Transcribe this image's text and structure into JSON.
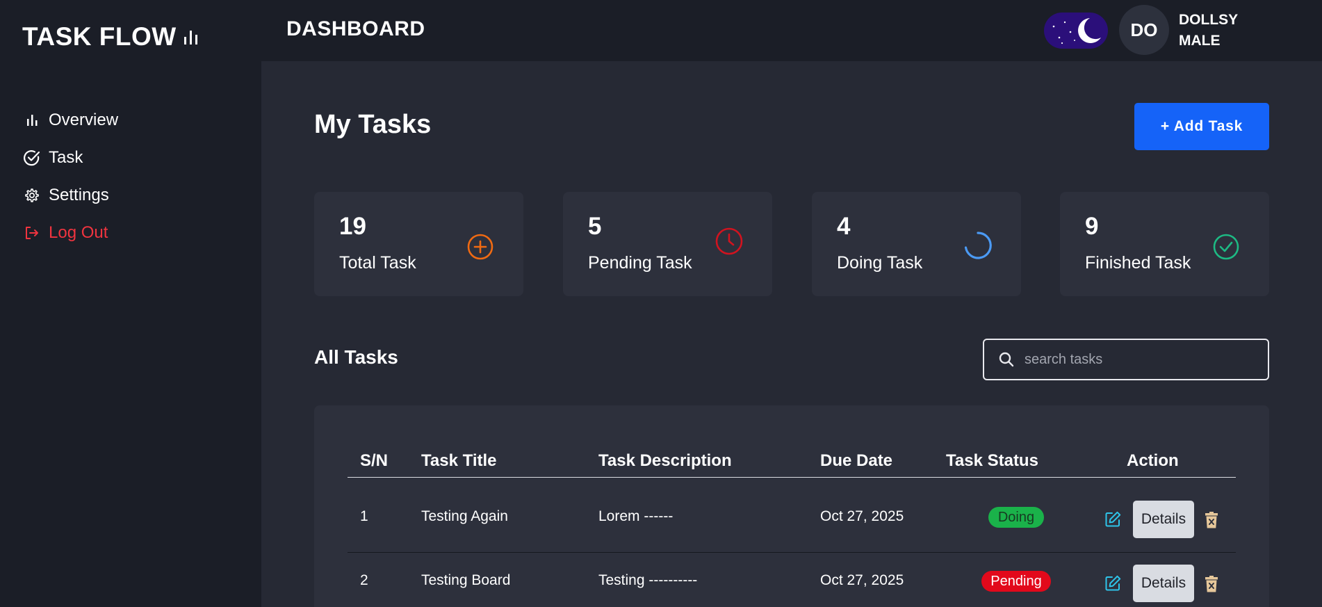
{
  "brand": {
    "title": "TASK FLOW"
  },
  "sidebar": {
    "items": [
      {
        "label": "Overview",
        "icon": "bar-chart-icon"
      },
      {
        "label": "Task",
        "icon": "check-circle-icon"
      },
      {
        "label": "Settings",
        "icon": "gear-icon"
      },
      {
        "label": "Log Out",
        "icon": "logout-icon",
        "color": "#f0343f"
      }
    ]
  },
  "header": {
    "title": "DASHBOARD",
    "avatar_initials": "DO",
    "user_first": "DOLLSY",
    "user_last": "MALE",
    "theme_toggle": "moon-icon"
  },
  "main": {
    "title": "My Tasks",
    "add_button": "+ Add Task",
    "stats": [
      {
        "value": "19",
        "label": "Total Task",
        "icon": "plus-circle-icon",
        "color": "#f06a12"
      },
      {
        "value": "5",
        "label": "Pending Task",
        "icon": "clock-icon",
        "color": "#d1131f"
      },
      {
        "value": "4",
        "label": "Doing Task",
        "icon": "spinner-icon",
        "color": "#4b9af4"
      },
      {
        "value": "9",
        "label": "Finished Task",
        "icon": "check-circle-icon",
        "color": "#1dba84"
      }
    ],
    "section_title": "All Tasks",
    "search_placeholder": "search tasks"
  },
  "table": {
    "headers": [
      "S/N",
      "Task Title",
      "Task Description",
      "Due Date",
      "Task Status",
      "Action"
    ],
    "rows": [
      {
        "sn": "1",
        "title": "Testing Again",
        "description": "Lorem ------",
        "due": "Oct 27, 2025",
        "status": "Doing",
        "details": "Details"
      },
      {
        "sn": "2",
        "title": "Testing Board",
        "description": "Testing ----------",
        "due": "Oct 27, 2025",
        "status": "Pending",
        "details": "Details"
      }
    ]
  },
  "colors": {
    "accent": "#1563f8",
    "sidebar_bg": "#1b1e27",
    "page_bg": "#262934",
    "card_bg": "#2d303c",
    "doing": "#1ab24a",
    "pending": "#e2091b"
  }
}
